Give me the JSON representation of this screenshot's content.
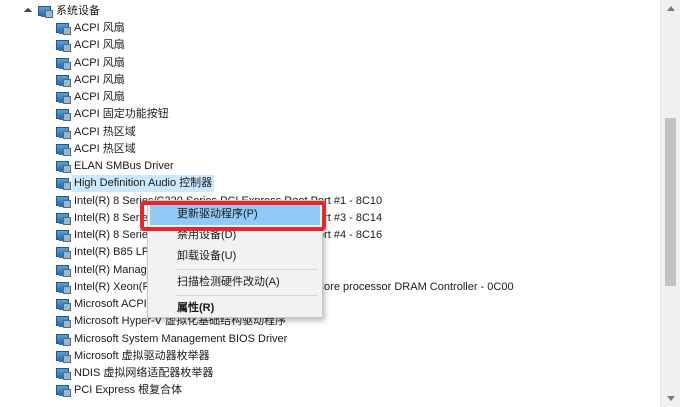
{
  "tree": {
    "category": {
      "label": "系统设备",
      "icon": "computer-device-icon",
      "expanded": true
    },
    "selected_index": 9,
    "items": [
      {
        "label": "ACPI 风扇"
      },
      {
        "label": "ACPI 风扇"
      },
      {
        "label": "ACPI 风扇"
      },
      {
        "label": "ACPI 风扇"
      },
      {
        "label": "ACPI 风扇"
      },
      {
        "label": "ACPI 固定功能按钮"
      },
      {
        "label": "ACPI 热区域"
      },
      {
        "label": "ACPI 热区域"
      },
      {
        "label": "ELAN SMBus Driver"
      },
      {
        "label": "High Definition Audio 控制器"
      },
      {
        "label": "Intel(R) 8 Series/C220 Series PCI Express Root Port #1 - 8C10"
      },
      {
        "label": "Intel(R) 8 Series/C220 Series PCI Express Root Port #3 - 8C14"
      },
      {
        "label": "Intel(R) 8 Series/C220 Series PCI Express Root Port #4 - 8C16"
      },
      {
        "label": "Intel(R) B85 LPC Controller - 8C50"
      },
      {
        "label": "Intel(R) Management Engine Interface"
      },
      {
        "label": "Intel(R) Xeon(R) processor E3 - 1200 v3/4th Gen Core processor DRAM Controller - 0C00"
      },
      {
        "label": "Microsoft ACPI-Compliant System"
      },
      {
        "label": "Microsoft Hyper-V 虚拟化基础结构驱动程序"
      },
      {
        "label": "Microsoft System Management BIOS Driver"
      },
      {
        "label": "Microsoft 虚拟驱动器枚举器"
      },
      {
        "label": "NDIS 虚拟网络适配器枚举器"
      },
      {
        "label": "PCI Express 根复合体"
      }
    ]
  },
  "context_menu": {
    "items": [
      {
        "label": "更新驱动程序(P)",
        "name": "update-driver",
        "hover": true
      },
      {
        "label": "禁用设备(D)",
        "name": "disable-device"
      },
      {
        "label": "卸载设备(U)",
        "name": "uninstall-device"
      },
      {
        "separator": true
      },
      {
        "label": "扫描检测硬件改动(A)",
        "name": "scan-hardware-changes"
      },
      {
        "separator": true
      },
      {
        "label": "属性(R)",
        "name": "properties",
        "bold": true
      }
    ]
  },
  "colors": {
    "highlight_box": "#e8262b",
    "menu_hover": "#91c9f7",
    "selection": "#cce8ff"
  }
}
